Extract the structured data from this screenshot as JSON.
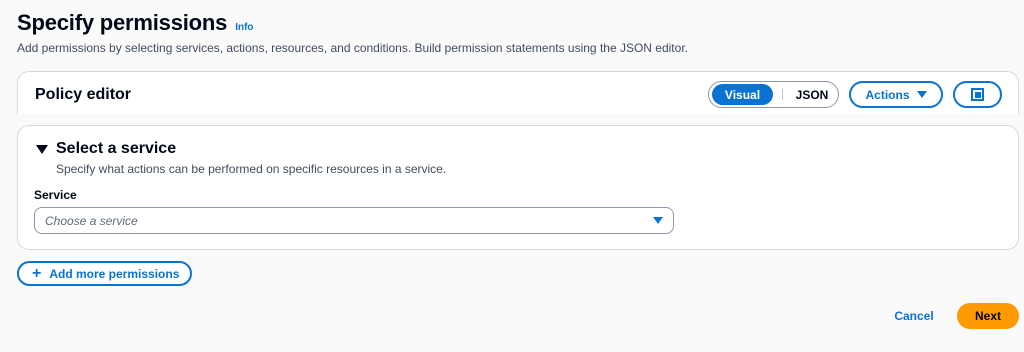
{
  "header": {
    "title": "Specify permissions",
    "info_label": "Info",
    "description": "Add permissions by selecting services, actions, resources, and conditions. Build permission statements using the JSON editor."
  },
  "policy_editor": {
    "title": "Policy editor",
    "mode_toggle": {
      "options": [
        "Visual",
        "JSON"
      ],
      "selected": "Visual"
    },
    "actions_label": "Actions",
    "icons": {
      "actions": "caret-down-icon",
      "fullscreen": "fullscreen-icon"
    }
  },
  "service_section": {
    "title": "Select a service",
    "description": "Specify what actions can be performed on specific resources in a service.",
    "field_label": "Service",
    "placeholder": "Choose a service",
    "icons": {
      "expand": "caret-down-icon",
      "select": "caret-down-icon"
    }
  },
  "add_more": {
    "icon": "+",
    "label": "Add more permissions"
  },
  "footer": {
    "cancel_label": "Cancel",
    "next_label": "Next"
  },
  "colors": {
    "accent": "#0972d3",
    "primary_button": "#ff9900",
    "background": "#fafafa"
  }
}
